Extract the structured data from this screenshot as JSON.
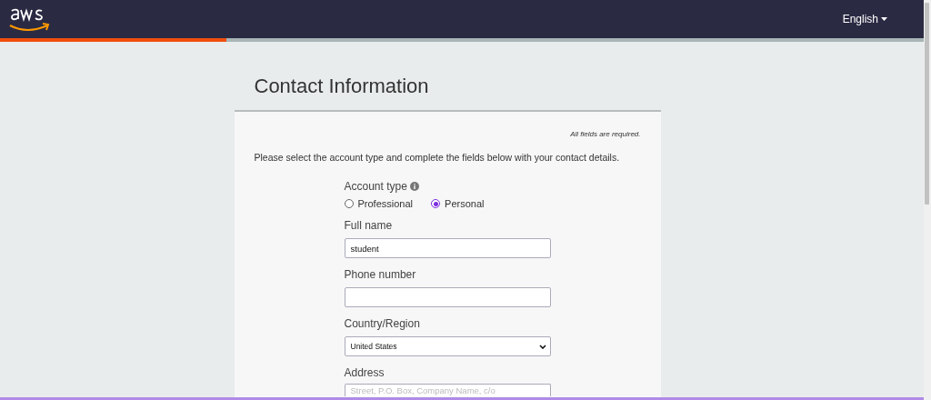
{
  "header": {
    "language": "English"
  },
  "progress": {
    "level": 0.245
  },
  "page": {
    "title": "Contact Information"
  },
  "form": {
    "required_note": "All fields are required.",
    "intro": "Please select the account type and complete the fields below with your contact details.",
    "account_type": {
      "label": "Account type",
      "options": [
        {
          "label": "Professional",
          "selected": false
        },
        {
          "label": "Personal",
          "selected": true
        }
      ]
    },
    "fields": [
      {
        "kind": "text",
        "label": "Full name",
        "value": "student"
      },
      {
        "kind": "text",
        "label": "Phone number"
      },
      {
        "kind": "select",
        "label": "Country/Region",
        "value": "United States"
      },
      {
        "kind": "text",
        "label": "Address",
        "placeholder": "Street, P.O. Box, Company Name, c/o"
      }
    ]
  }
}
